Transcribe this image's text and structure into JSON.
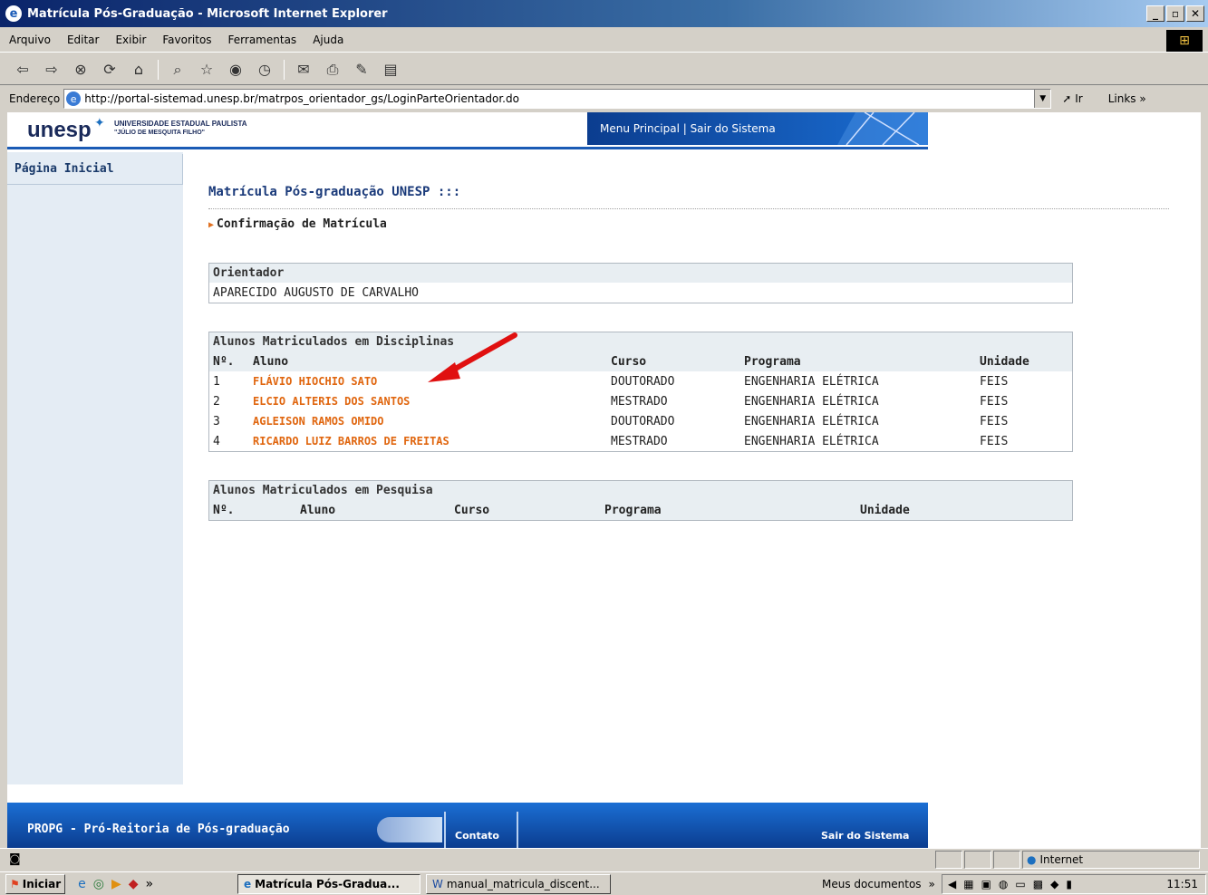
{
  "window": {
    "title": "Matrícula Pós-Graduação - Microsoft Internet Explorer"
  },
  "menu": [
    "Arquivo",
    "Editar",
    "Exibir",
    "Favoritos",
    "Ferramentas",
    "Ajuda"
  ],
  "address": {
    "label": "Endereço",
    "url": "http://portal-sistemad.unesp.br/matrpos_orientador_gs/LoginParteOrientador.do",
    "go": "Ir",
    "links": "Links"
  },
  "header": {
    "logo": "unesp",
    "university_line1": "UNIVERSIDADE ESTADUAL PAULISTA",
    "university_line2": "\"JÚLIO DE MESQUITA FILHO\"",
    "nav": "Menu Principal | Sair do Sistema"
  },
  "sidebar": {
    "items": [
      {
        "label": "Página Inicial"
      }
    ]
  },
  "main": {
    "title": "Matrícula Pós-graduação UNESP :::",
    "subtitle": "Confirmação de Matrícula",
    "orientador": {
      "heading": "Orientador",
      "name": "APARECIDO AUGUSTO DE CARVALHO"
    },
    "disciplinas": {
      "heading": "Alunos Matriculados em Disciplinas",
      "columns": [
        "Nº.",
        "Aluno",
        "Curso",
        "Programa",
        "Unidade"
      ],
      "rows": [
        {
          "n": "1",
          "aluno": "FLÁVIO HIOCHIO SATO",
          "curso": "DOUTORADO",
          "programa": "ENGENHARIA ELÉTRICA",
          "unidade": "FEIS"
        },
        {
          "n": "2",
          "aluno": "ELCIO ALTERIS DOS SANTOS",
          "curso": "MESTRADO",
          "programa": "ENGENHARIA ELÉTRICA",
          "unidade": "FEIS"
        },
        {
          "n": "3",
          "aluno": "AGLEISON RAMOS OMIDO",
          "curso": "DOUTORADO",
          "programa": "ENGENHARIA ELÉTRICA",
          "unidade": "FEIS"
        },
        {
          "n": "4",
          "aluno": "RICARDO LUIZ BARROS DE FREITAS",
          "curso": "MESTRADO",
          "programa": "ENGENHARIA ELÉTRICA",
          "unidade": "FEIS"
        }
      ]
    },
    "pesquisa": {
      "heading": "Alunos Matriculados em Pesquisa",
      "columns": [
        "Nº.",
        "Aluno",
        "Curso",
        "Programa",
        "Unidade"
      ]
    }
  },
  "footer": {
    "left": "PROPG - Pró-Reitoria de Pós-graduação",
    "contato": "Contato",
    "sair": "Sair do Sistema"
  },
  "status": {
    "zone": "Internet"
  },
  "taskbar": {
    "start": "Iniciar",
    "tasks": [
      "Matrícula Pós-Gradua...",
      "manual_matricula_discent..."
    ],
    "tray_label": "Meus documentos",
    "clock": "11:51"
  },
  "colors": {
    "link_orange": "#e0660f",
    "brand_blue": "#1b5bb5"
  }
}
